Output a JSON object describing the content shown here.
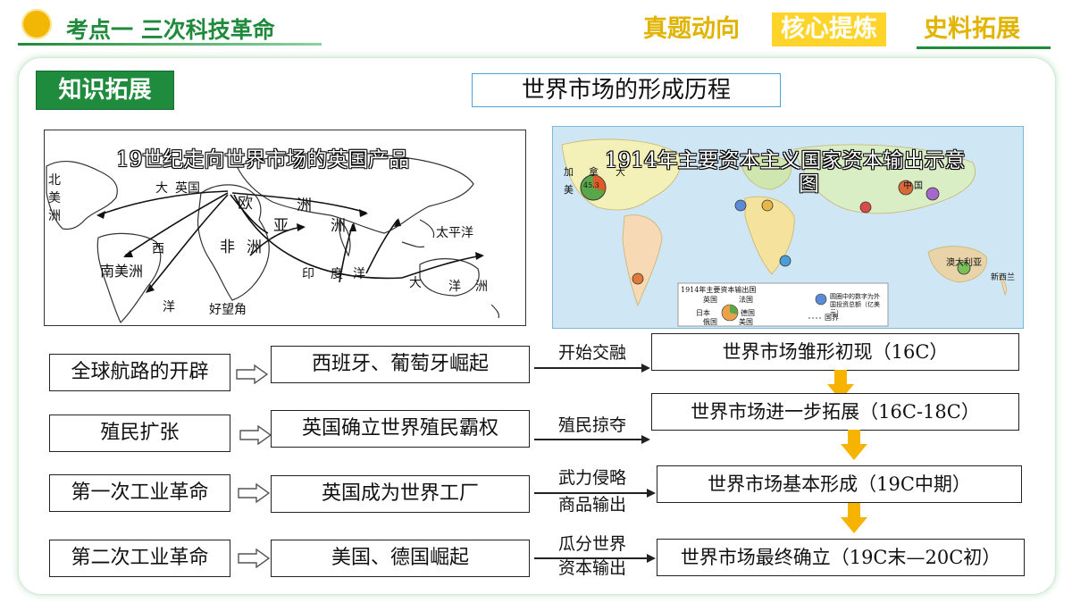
{
  "header": {
    "title": "考点一  三次科技革命",
    "tabs": [
      "真题动向",
      "核心提炼",
      "史料拓展"
    ],
    "active_tab": "核心提炼",
    "accent": "#1f8a3b",
    "tab_color": "#e0b400",
    "active_tab_bg": "#ffd42a"
  },
  "panel": {
    "tag": "知识拓展",
    "title": "世界市场的形成历程"
  },
  "map1": {
    "caption": "19世纪走向世界市场的英国产品",
    "labels": [
      "北",
      "美",
      "洲",
      "大",
      "英国",
      "欧",
      "洲",
      "亚",
      "洲",
      "非",
      "洲",
      "西",
      "南美洲",
      "印",
      "度",
      "洋",
      "太平洋",
      "大",
      "洋",
      "洲",
      "洋",
      "好望角"
    ]
  },
  "map2": {
    "caption_line1": "1914年主要资本主义国家资本输出示意",
    "caption_line2": "图",
    "legend_title": "1914年主要资本输出国",
    "legend_items": [
      "英国",
      "法国",
      "日本",
      "德国",
      "俄国",
      "美国"
    ],
    "legend_note": "圆圈中的数字为外国投资总额（亿美元）",
    "legend_border": "国界",
    "pie_value": "45.3",
    "labels": [
      "加",
      "拿",
      "大",
      "美",
      "中",
      "国",
      "澳大利亚",
      "新西兰"
    ]
  },
  "flow": {
    "rows": [
      {
        "cause": "全球航路的开辟",
        "effect": "西班牙、葡萄牙崛起",
        "link": [
          "开始交融"
        ],
        "stage": "世界市场雏形初现（16C）"
      },
      {
        "cause": "殖民扩张",
        "effect": "英国确立世界殖民霸权",
        "link": [
          "殖民掠夺"
        ],
        "stage": "世界市场进一步拓展（16C-18C）"
      },
      {
        "cause": "第一次工业革命",
        "effect": "英国成为世界工厂",
        "link": [
          "武力侵略",
          "商品输出"
        ],
        "stage": "世界市场基本形成（19C中期）"
      },
      {
        "cause": "第二次工业革命",
        "effect": "美国、德国崛起",
        "link": [
          "瓜分世界",
          "资本输出"
        ],
        "stage": "世界市场最终确立（19C末—20C初）"
      }
    ],
    "down_arrow_color": "#f6b400"
  }
}
